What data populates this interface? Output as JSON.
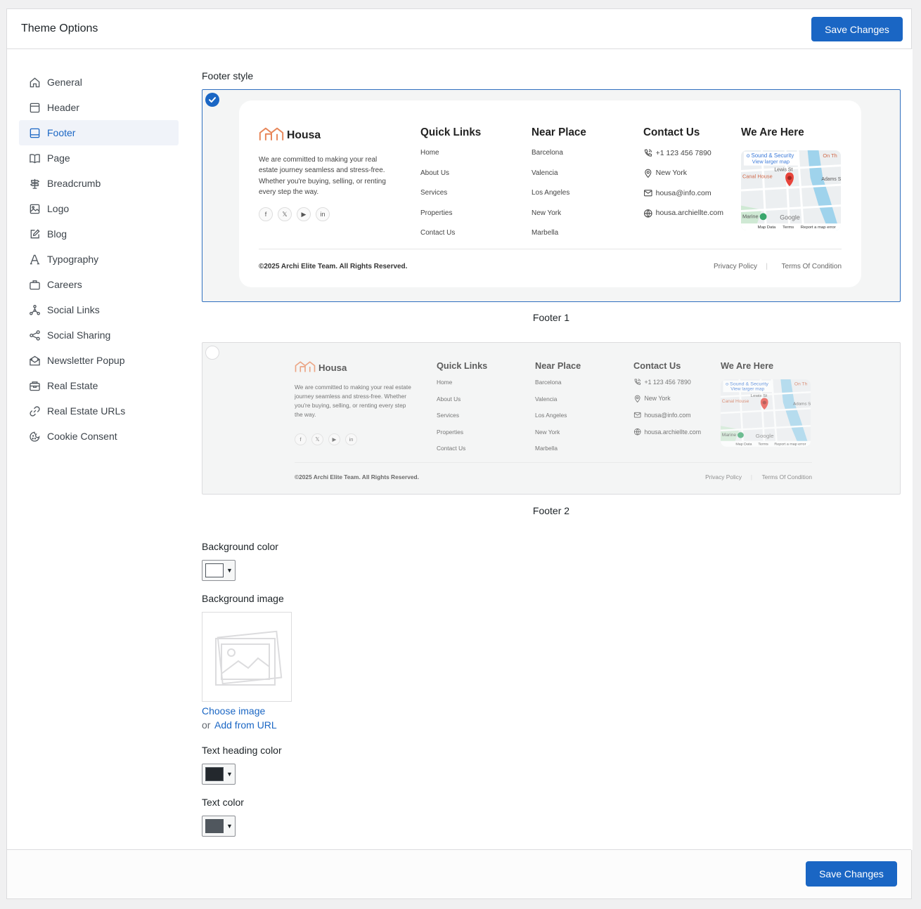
{
  "header": {
    "title": "Theme Options",
    "save_label": "Save Changes"
  },
  "sidebar": {
    "items": [
      {
        "label": "General",
        "icon": "home-icon"
      },
      {
        "label": "Header",
        "icon": "header-icon"
      },
      {
        "label": "Footer",
        "icon": "footer-icon",
        "active": true
      },
      {
        "label": "Page",
        "icon": "book-icon"
      },
      {
        "label": "Breadcrumb",
        "icon": "signpost-icon"
      },
      {
        "label": "Logo",
        "icon": "image-icon"
      },
      {
        "label": "Blog",
        "icon": "edit-icon"
      },
      {
        "label": "Typography",
        "icon": "typography-icon"
      },
      {
        "label": "Careers",
        "icon": "briefcase-icon"
      },
      {
        "label": "Social Links",
        "icon": "network-icon"
      },
      {
        "label": "Social Sharing",
        "icon": "share-icon"
      },
      {
        "label": "Newsletter Popup",
        "icon": "mail-open-icon"
      },
      {
        "label": "Real Estate",
        "icon": "building-icon"
      },
      {
        "label": "Real Estate URLs",
        "icon": "link-icon"
      },
      {
        "label": "Cookie Consent",
        "icon": "cookie-icon"
      }
    ]
  },
  "main": {
    "footer_style_label": "Footer style",
    "footers": [
      {
        "caption": "Footer 1",
        "selected": true
      },
      {
        "caption": "Footer 2",
        "selected": false
      }
    ],
    "preview": {
      "brand": "Housa",
      "about": "We are committed to making your real estate journey seamless and stress-free. Whether you're buying, selling, or renting every step the way.",
      "quick_links_title": "Quick Links",
      "quick_links": [
        "Home",
        "About Us",
        "Services",
        "Properties",
        "Contact Us"
      ],
      "near_place_title": "Near Place",
      "near_places": [
        "Barcelona",
        "Valencia",
        "Los Angeles",
        "New York",
        "Marbella"
      ],
      "contact_title": "Contact Us",
      "contacts": [
        "+1 123 456 7890",
        "New York",
        "housa@info.com",
        "housa.archiellte.com"
      ],
      "map_title": "We Are Here",
      "map_labels": [
        "o Sound & Security",
        "View larger map",
        "Lewis St",
        "Canal House",
        "Google",
        "Map Data",
        "Terms",
        "Report a map error",
        "On Th",
        "Adams St",
        "Marine"
      ],
      "copyright": "©2025 Archi Elite Team. All Rights Reserved.",
      "privacy": "Privacy Policy",
      "terms": "Terms Of Condition"
    },
    "background_color_label": "Background color",
    "background_color": "#ffffff",
    "background_image_label": "Background image",
    "choose_image": "Choose image",
    "or_text": "or",
    "add_from_url": "Add from URL",
    "text_heading_color_label": "Text heading color",
    "text_heading_color": "#23282d",
    "text_color_label": "Text color",
    "text_color": "#50575e"
  },
  "colors": {
    "accent": "#1a66c4",
    "brand_orange": "#e8875a"
  }
}
